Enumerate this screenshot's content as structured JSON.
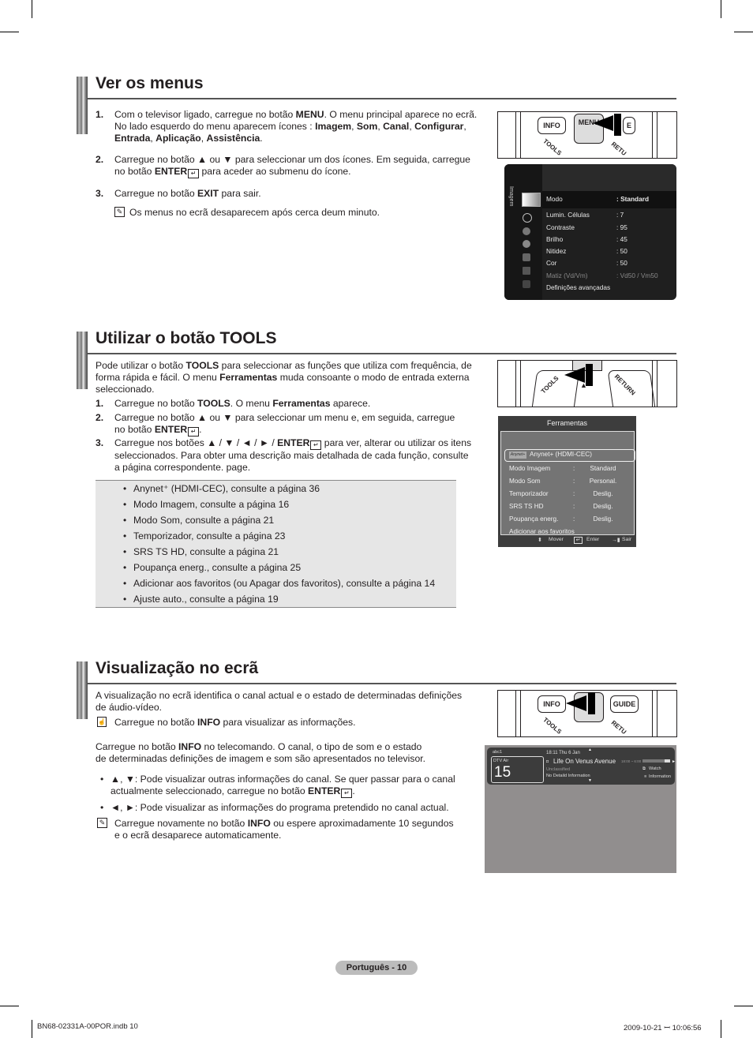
{
  "sections": [
    {
      "title": "Ver os menus",
      "steps": [
        {
          "num": "1.",
          "line1_a": "Com o televisor ligado, carregue no botão ",
          "line1_b": "MENU",
          "line1_c": ". O menu principal aparece no ecrã.",
          "line2_a": "No lado esquerdo do menu aparecem ícones : ",
          "line2_b": "Imagem",
          "line2_c": ", ",
          "line2_d": "Som",
          "line2_e": ", ",
          "line2_f": "Canal",
          "line2_g": ", ",
          "line2_h": "Configurar",
          "line2_i": ",",
          "line3_a": "Entrada",
          "line3_b": ", ",
          "line3_c": "Aplicação",
          "line3_d": ", ",
          "line3_e": "Assistência",
          "line3_f": "."
        },
        {
          "num": "2.",
          "line1": "Carregue no botão ▲ ou ▼ para seleccionar um dos ícones. Em seguida, carregue",
          "line2_a": "no botão ",
          "line2_b": "ENTER",
          "line2_c": " para aceder ao submenu do ícone."
        },
        {
          "num": "3.",
          "line1_a": "Carregue no botão ",
          "line1_b": "EXIT",
          "line1_c": " para sair."
        }
      ],
      "note": "Os menus no ecrã desaparecem após cerca deum minuto."
    },
    {
      "title": "Utilizar o botão TOOLS",
      "intro_1a": "Pode utilizar o botão ",
      "intro_1b": "TOOLS",
      "intro_1c": " para seleccionar as funções que utiliza com frequência, de",
      "intro_2a": "forma rápida e fácil. O menu ",
      "intro_2b": "Ferramentas",
      "intro_2c": " muda consoante o modo de entrada externa",
      "intro_3": "seleccionado.",
      "steps": [
        {
          "num": "1.",
          "a": "Carregue no botão ",
          "b": "TOOLS",
          "c": ". O menu ",
          "d": "Ferramentas",
          "e": " aparece."
        },
        {
          "num": "2.",
          "line1": "Carregue no botão ▲ ou ▼ para seleccionar um menu e, em seguida, carregue",
          "line2_a": "no botão ",
          "line2_b": "ENTER",
          "line2_c": "."
        },
        {
          "num": "3.",
          "line1_a": "Carregue nos botões ▲ / ▼ / ◄ / ► / ",
          "line1_b": "ENTER",
          "line1_c": " para ver, alterar ou utilizar os itens",
          "line2": "seleccionados. Para obter uma descrição mais detalhada de cada função, consulte",
          "line3": "a página correspondente. page."
        }
      ],
      "bullets": [
        "Anynet⁺ (HDMI-CEC), consulte a página 36",
        "Modo Imagem, consulte a página 16",
        "Modo Som, consulte a página 21",
        "Temporizador, consulte a página 23",
        "SRS TS HD, consulte a página 21",
        "Poupança energ., consulte a página 25",
        "Adicionar aos favoritos (ou Apagar dos favoritos), consulte a página 14",
        "Ajuste auto., consulte a página 19"
      ]
    },
    {
      "title": "Visualização no ecrã",
      "intro_1": "A visualização no ecrã identifica o canal actual e o estado de determinadas definições",
      "intro_2": "de áudio-vídeo.",
      "remote_note_a": "Carregue no botão ",
      "remote_note_b": "INFO",
      "remote_note_c": " para visualizar as informações.",
      "para_1a": "Carregue no botão ",
      "para_1b": "INFO",
      "para_1c": " no telecomando. O canal, o tipo de som e o estado",
      "para_2": "de determinadas definições de imagem e som são apresentados no televisor.",
      "bullet1_line1": "▲, ▼: Pode visualizar outras informações do canal. Se quer passar para o canal",
      "bullet1_line2a": "actualmente seleccionado, carregue no botão ",
      "bullet1_line2b": "ENTER",
      "bullet1_line2c": ".",
      "bullet2": "◄, ►: Pode visualizar as informações do programa pretendido no canal actual.",
      "note_1a": "Carregue novamente no botão ",
      "note_1b": "INFO",
      "note_1c": " ou espere aproximadamente 10 segundos",
      "note_2": "e o ecrã desaparece automaticamente."
    }
  ],
  "remotes": {
    "menu": {
      "info": "INFO",
      "menu": "MENU",
      "e": "E",
      "tools": "TOOLS",
      "return": "RETU"
    },
    "tools": {
      "tools": "TOOLS",
      "return": "RETURN"
    },
    "info": {
      "info": "INFO",
      "guide": "GUIDE",
      "tools": "TOOLS",
      "return": "RETU"
    }
  },
  "image_menu": {
    "side_label": "Imagem",
    "rows": [
      {
        "label": "Modo",
        "value": ": Standard",
        "selected": true
      },
      {
        "label": "Lumin. Células",
        "value": ": 7"
      },
      {
        "label": "Contraste",
        "value": ": 95"
      },
      {
        "label": "Brilho",
        "value": ": 45"
      },
      {
        "label": "Nitidez",
        "value": ": 50"
      },
      {
        "label": "Cor",
        "value": ": 50"
      },
      {
        "label": "Matiz (Vd/Vm)",
        "value": ": Vd50 / Vm50",
        "disabled": true
      },
      {
        "label": "Definições avançadas",
        "value": ""
      }
    ]
  },
  "tools_menu": {
    "title": "Ferramentas",
    "anynet_logo": "Anynet+",
    "anynet_label": "Anynet+ (HDMI-CEC)",
    "rows": [
      {
        "label": "Modo Imagem",
        "sep": ":",
        "value": "Standard"
      },
      {
        "label": "Modo Som",
        "sep": ":",
        "value": "Personal."
      },
      {
        "label": "Temporizador",
        "sep": ":",
        "value": "Deslig."
      },
      {
        "label": "SRS TS HD",
        "sep": ":",
        "value": "Deslig."
      },
      {
        "label": "Poupança energ.",
        "sep": ":",
        "value": "Deslig."
      },
      {
        "label": "Adicionar aos favoritos",
        "sep": "",
        "value": ""
      }
    ],
    "footer": {
      "move": "Mover",
      "enter": "Enter",
      "exit": "Sair"
    }
  },
  "info_osd": {
    "channel_name": "abc1",
    "source": "DTV Air",
    "channel_number": "15",
    "datetime": "18:11 Thu 6 Jan",
    "program": "Life On Venus Avenue",
    "rating": "Unclassified",
    "details": "No Detaild Information",
    "time_range": "18:00 ~ 6:00",
    "watch": "Watch",
    "information": "Information"
  },
  "page_label": "Português - 10",
  "footer": {
    "file": "BN68-02331A-00POR.indb   10",
    "timestamp": "2009-10-21   ꟷ 10:06:56"
  }
}
